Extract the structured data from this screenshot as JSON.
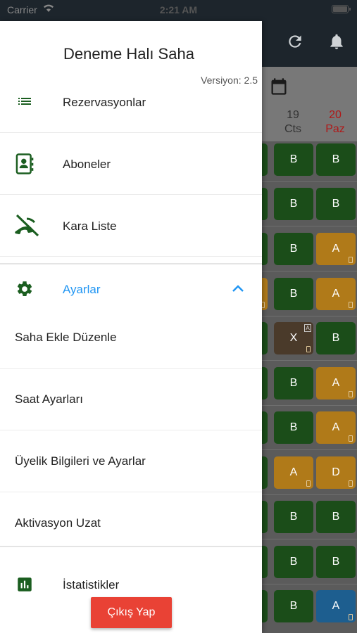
{
  "status_bar": {
    "carrier": "Carrier",
    "time": "2:21 AM"
  },
  "background": {
    "days": [
      {
        "num": "19",
        "name": "Cts",
        "red": false
      },
      {
        "num": "20",
        "name": "Paz",
        "red": true
      }
    ],
    "rows": [
      [
        "B",
        "B"
      ],
      [
        "B",
        "B"
      ],
      [
        "B",
        "A"
      ],
      [
        "B",
        "A"
      ],
      [
        "X",
        "B"
      ],
      [
        "B",
        "A"
      ],
      [
        "B",
        "A"
      ],
      [
        "A",
        "D"
      ],
      [
        "B",
        "B"
      ],
      [
        "B",
        "B"
      ],
      [
        "B",
        "A"
      ]
    ],
    "badge": "A"
  },
  "drawer": {
    "title": "Deneme Halı Saha",
    "version": "Versiyon: 2.5",
    "items": {
      "reservations": "Rezervasyonlar",
      "subscribers": "Aboneler",
      "blacklist": "Kara Liste",
      "settings": "Ayarlar",
      "add_field": "Saha Ekle Düzenle",
      "hour_settings": "Saat Ayarları",
      "membership": "Üyelik Bilgileri ve Ayarlar",
      "activation": "Aktivasyon Uzat",
      "statistics": "İstatistikler"
    },
    "logout": "Çıkış Yap"
  },
  "colors": {
    "accent_blue": "#2196f3",
    "icon_green": "#1b5e20",
    "logout_red": "#e94235"
  }
}
